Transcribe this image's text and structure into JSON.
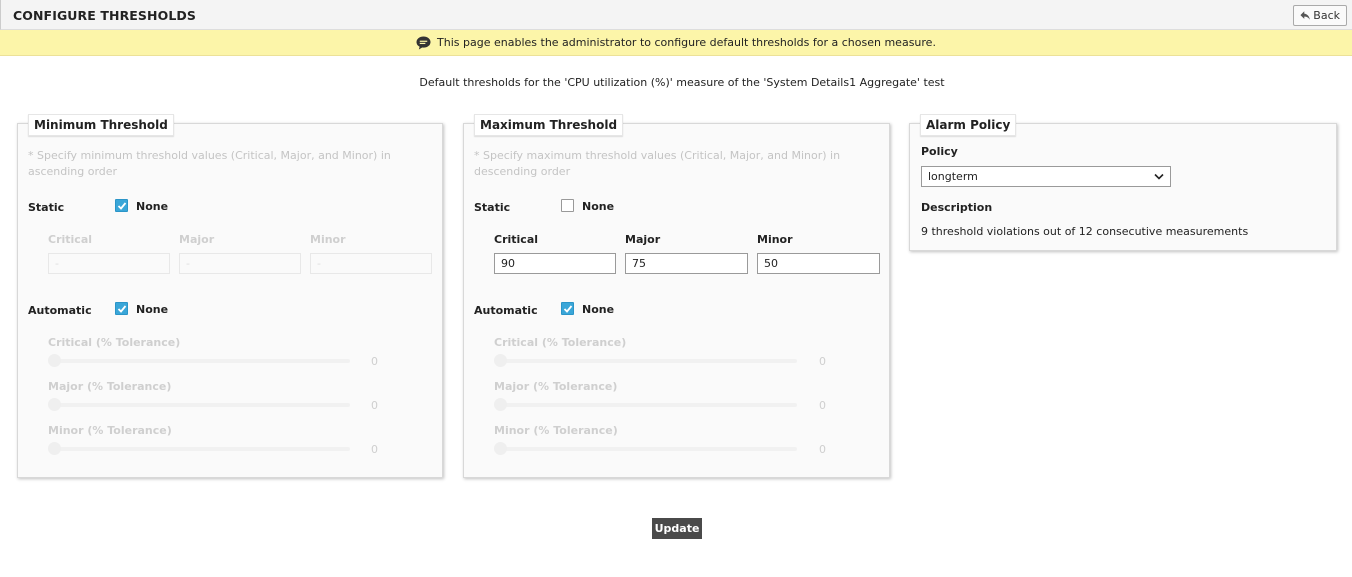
{
  "header": {
    "title": "CONFIGURE THRESHOLDS",
    "back_label": "Back"
  },
  "info": {
    "message": "This page enables the administrator to configure default thresholds for a chosen measure."
  },
  "subtitle": "Default thresholds for the 'CPU utilization (%)' measure of the 'System Details1 Aggregate' test",
  "min_panel": {
    "title": "Minimum Threshold",
    "hint_line1": "* Specify minimum threshold values (Critical, Major, and Minor) in",
    "hint_line2": "ascending order",
    "static_label": "Static",
    "static_none_checked": true,
    "none_label": "None",
    "columns": [
      "Critical",
      "Major",
      "Minor"
    ],
    "values": [
      "-",
      "-",
      "-"
    ],
    "automatic_label": "Automatic",
    "automatic_none_checked": true,
    "sliders": [
      {
        "label": "Critical (% Tolerance)",
        "value": "0"
      },
      {
        "label": "Major (% Tolerance)",
        "value": "0"
      },
      {
        "label": "Minor (% Tolerance)",
        "value": "0"
      }
    ]
  },
  "max_panel": {
    "title": "Maximum Threshold",
    "hint_line1": "* Specify maximum threshold values (Critical, Major, and Minor) in",
    "hint_line2": "descending order",
    "static_label": "Static",
    "static_none_checked": false,
    "none_label": "None",
    "columns": [
      "Critical",
      "Major",
      "Minor"
    ],
    "values": [
      "90",
      "75",
      "50"
    ],
    "automatic_label": "Automatic",
    "automatic_none_checked": true,
    "sliders": [
      {
        "label": "Critical (% Tolerance)",
        "value": "0"
      },
      {
        "label": "Major (% Tolerance)",
        "value": "0"
      },
      {
        "label": "Minor (% Tolerance)",
        "value": "0"
      }
    ]
  },
  "alarm_panel": {
    "title": "Alarm Policy",
    "policy_label": "Policy",
    "policy_value": "longterm",
    "description_label": "Description",
    "description_text": "9 threshold violations out of 12 consecutive measurements"
  },
  "update_label": "Update",
  "colors": {
    "accent_check": "#3aa6d8",
    "info_bg": "#fcf5a9",
    "button_dark": "#4a4a4a"
  }
}
